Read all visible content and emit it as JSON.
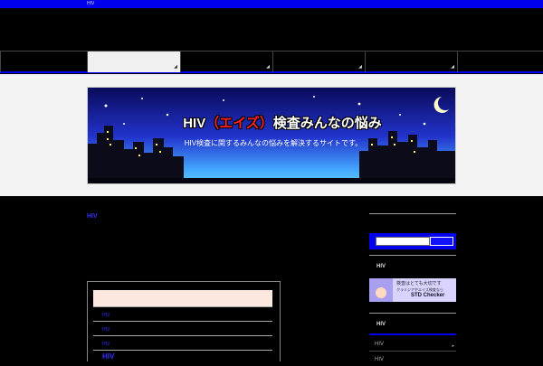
{
  "topbar": {
    "text": "HIV"
  },
  "nav": {
    "items": [
      "",
      "",
      "",
      "",
      ""
    ],
    "arrow": "◢"
  },
  "banner": {
    "title_prefix": "HIV",
    "title_highlight": "（エイズ）",
    "title_suffix": "検査みんなの悩み",
    "subtitle": "HIV検査に関するみんなの悩みを解決するサイトです。"
  },
  "main": {
    "title": "HIV",
    "box": {
      "rows": [
        "HIV",
        "HIV",
        "HIV",
        "HIV"
      ]
    }
  },
  "sidebar": {
    "search": {
      "value": "",
      "placeholder": ""
    },
    "heading1": "HIV",
    "ad": {
      "line1": "検査はとても大切です",
      "line2": "クラミジアやエイズ検査なら",
      "line3": "STD Checker"
    },
    "heading2": "HIV",
    "links": [
      "HIV",
      "HIV"
    ]
  },
  "colors": {
    "accent": "#0000ee",
    "banner_title_red": "#ff2222"
  }
}
